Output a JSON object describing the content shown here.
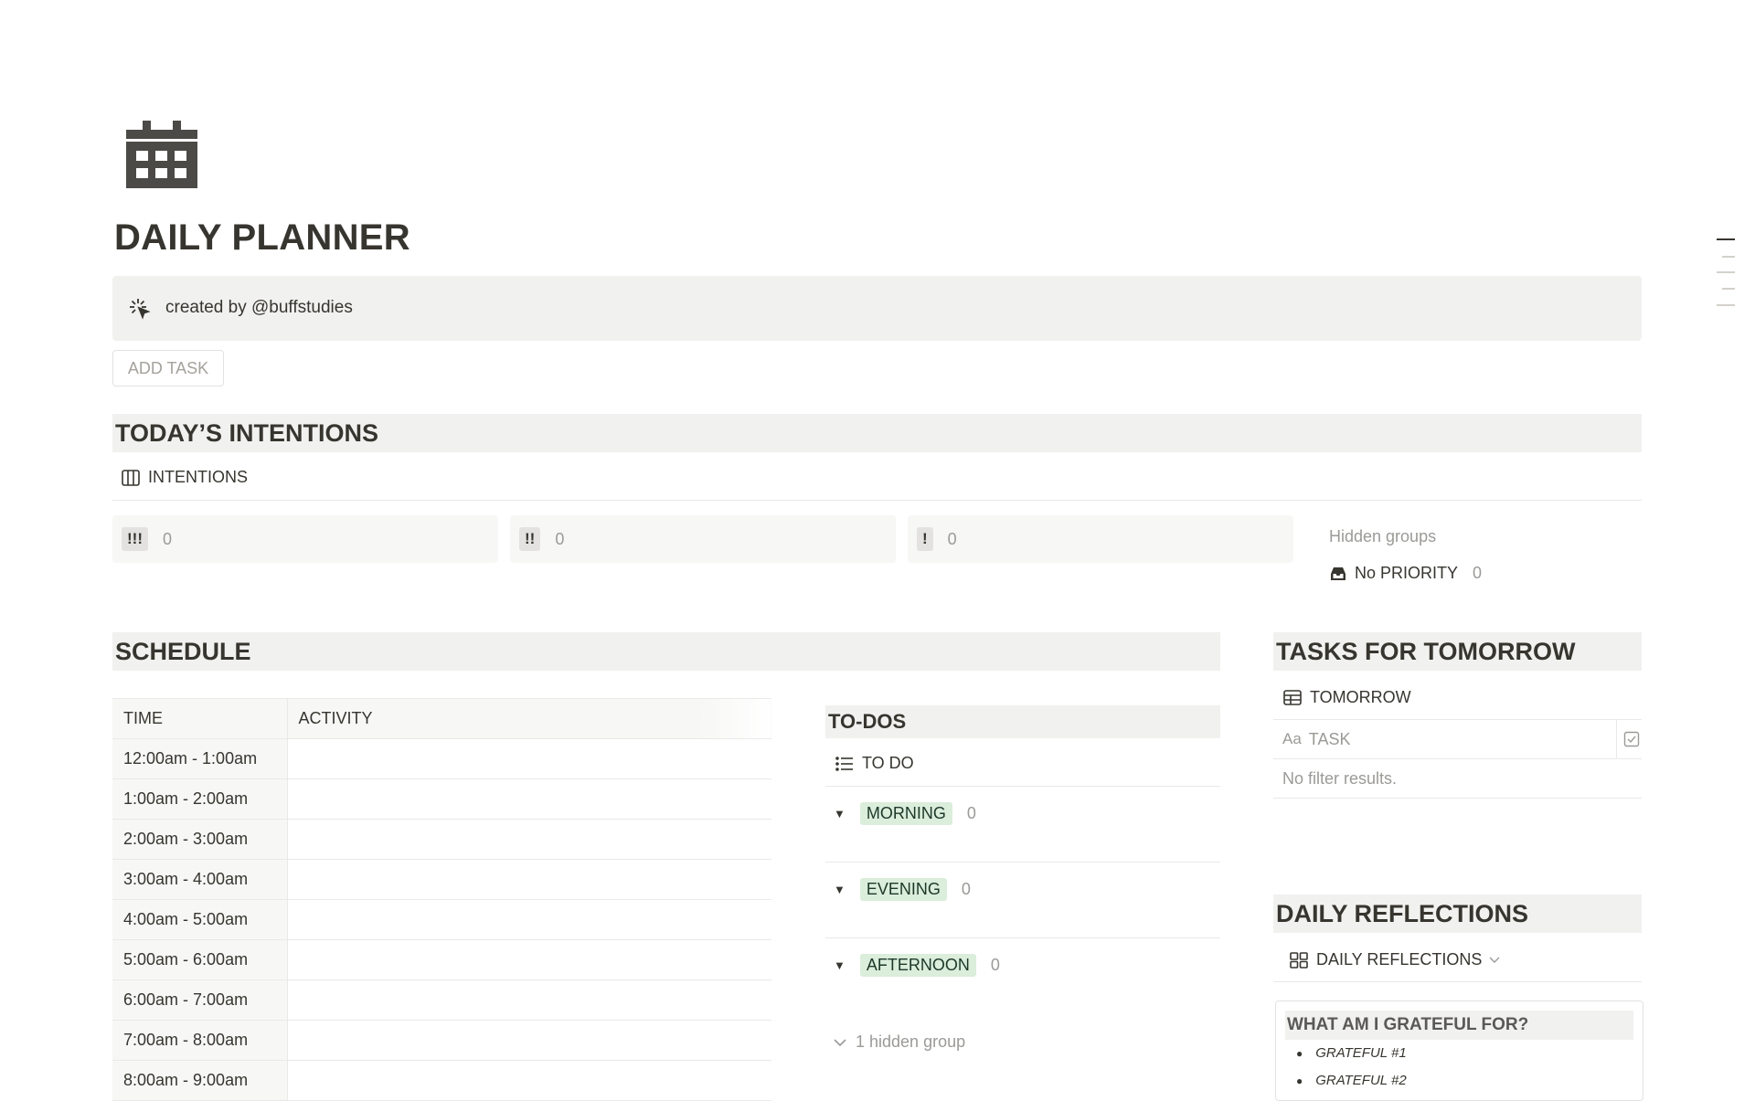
{
  "page": {
    "icon": "calendar-icon",
    "title": "DAILY PLANNER",
    "callout": {
      "icon": "sparkle-cursor-icon",
      "text": "created by @buffstudies"
    },
    "add_task_button": "ADD TASK"
  },
  "intentions": {
    "heading": "TODAY’S INTENTIONS",
    "view_label": "INTENTIONS",
    "view_icon": "board-icon",
    "columns": [
      {
        "label": "!!!",
        "count": "0"
      },
      {
        "label": "!!",
        "count": "0"
      },
      {
        "label": "!",
        "count": "0"
      }
    ],
    "hidden_groups_label": "Hidden groups",
    "hidden_group": {
      "icon": "inbox-icon",
      "label": "No PRIORITY",
      "count": "0"
    }
  },
  "schedule": {
    "heading": "SCHEDULE",
    "columns": [
      "TIME",
      "ACTIVITY"
    ],
    "rows": [
      "12:00am - 1:00am",
      "1:00am - 2:00am",
      "2:00am - 3:00am",
      "3:00am - 4:00am",
      "4:00am - 5:00am",
      "5:00am - 6:00am",
      "6:00am - 7:00am",
      "7:00am - 8:00am",
      "8:00am - 9:00am"
    ]
  },
  "todos": {
    "heading": "TO-DOS",
    "view_label": "TO DO",
    "view_icon": "list-icon",
    "groups": [
      {
        "label": "MORNING",
        "count": "0"
      },
      {
        "label": "EVENING",
        "count": "0"
      },
      {
        "label": "AFTERNOON",
        "count": "0"
      }
    ],
    "hidden_group_text": "1 hidden group"
  },
  "tomorrow": {
    "heading": "TASKS FOR TOMORROW",
    "view_label": "TOMORROW",
    "view_icon": "table-icon",
    "column_prefix": "Aa",
    "column_label": "TASK",
    "empty_text": "No filter results."
  },
  "reflections": {
    "heading": "DAILY REFLECTIONS",
    "view_label": "DAILY REFLECTIONS",
    "view_icon": "gallery-icon",
    "card_title": "WHAT AM I GRATEFUL FOR?",
    "bullets": [
      "GRATEFUL #1",
      "GRATEFUL #2"
    ]
  }
}
